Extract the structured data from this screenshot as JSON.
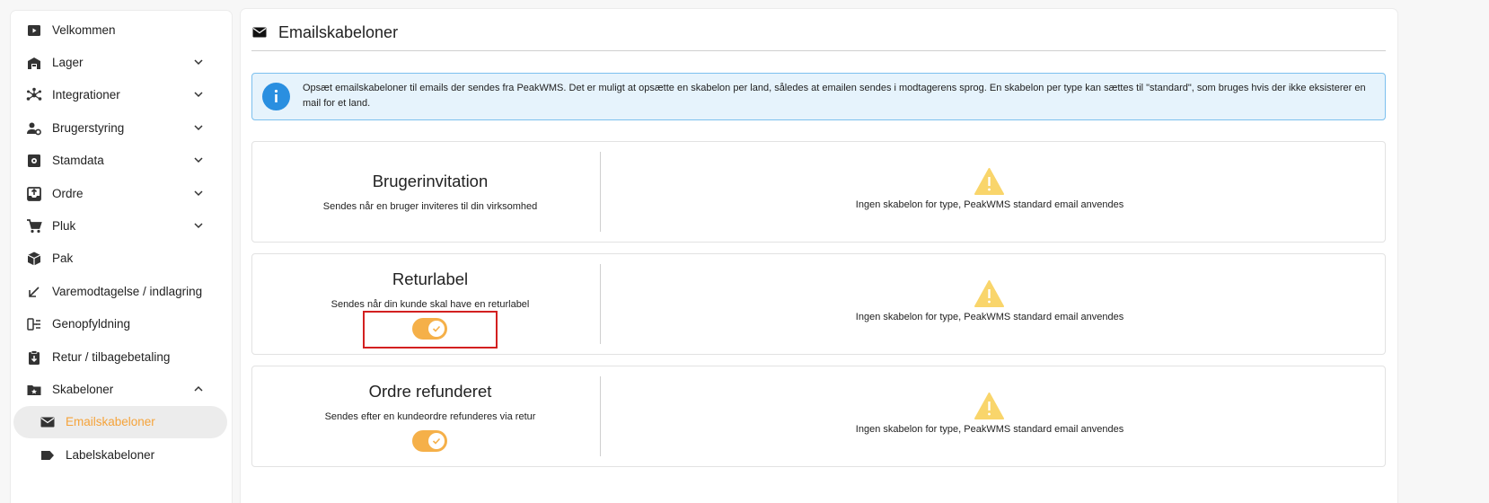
{
  "sidebar": {
    "items": [
      {
        "label": "Velkommen",
        "icon": "play-icon"
      },
      {
        "label": "Lager",
        "icon": "warehouse-icon",
        "chevron": "down"
      },
      {
        "label": "Integrationer",
        "icon": "hub-icon",
        "chevron": "down"
      },
      {
        "label": "Brugerstyring",
        "icon": "user-settings-icon",
        "chevron": "down"
      },
      {
        "label": "Stamdata",
        "icon": "cog-box-icon",
        "chevron": "down"
      },
      {
        "label": "Ordre",
        "icon": "inbox-upload-icon",
        "chevron": "down"
      },
      {
        "label": "Pluk",
        "icon": "cart-icon",
        "chevron": "down"
      },
      {
        "label": "Pak",
        "icon": "package-icon"
      },
      {
        "label": "Varemodtagelse / indlagring",
        "icon": "arrow-down-left-icon"
      },
      {
        "label": "Genopfyldning",
        "icon": "refill-icon"
      },
      {
        "label": "Retur / tilbagebetaling",
        "icon": "clipboard-return-icon"
      },
      {
        "label": "Skabeloner",
        "icon": "template-folder-icon",
        "chevron": "up"
      }
    ],
    "subitems": [
      {
        "label": "Emailskabeloner",
        "icon": "mail-icon",
        "active": true
      },
      {
        "label": "Labelskabeloner",
        "icon": "label-icon"
      }
    ]
  },
  "main": {
    "title": "Emailskabeloner",
    "title_icon": "mail-icon",
    "info": "Opsæt emailskabeloner til emails der sendes fra PeakWMS. Det er muligt at opsætte en skabelon per land, således at emailen sendes i modtagerens sprog. En skabelon per type kan sættes til \"standard\", som bruges hvis der ikke eksisterer en mail for et land.",
    "cards": [
      {
        "title": "Brugerinvitation",
        "description": "Sendes når en bruger inviteres til din virksomhed",
        "has_toggle": false,
        "message": "Ingen skabelon for type, PeakWMS standard email anvendes"
      },
      {
        "title": "Returlabel",
        "description": "Sendes når din kunde skal have en returlabel",
        "has_toggle": true,
        "toggle_on": true,
        "message": "Ingen skabelon for type, PeakWMS standard email anvendes"
      },
      {
        "title": "Ordre refunderet",
        "description": "Sendes efter en kundeordre refunderes via retur",
        "has_toggle": true,
        "toggle_on": true,
        "message": "Ingen skabelon for type, PeakWMS standard email anvendes"
      }
    ]
  },
  "colors": {
    "accent": "#f5a33a",
    "toggle_on": "#f5b049",
    "info_bg": "#e6f3fc",
    "info_border": "#7cc0ee",
    "info_icon": "#2a8fe0",
    "warning": "#f9d56b",
    "highlight": "#d32020"
  }
}
